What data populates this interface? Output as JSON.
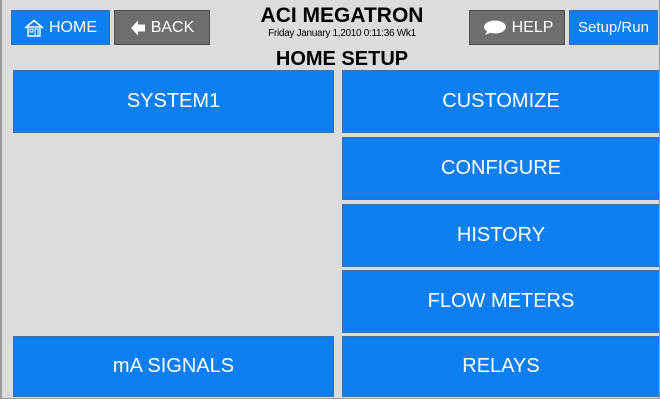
{
  "header": {
    "home_label": "HOME",
    "back_label": "BACK",
    "app_title": "ACI MEGATRON",
    "timestamp": "Friday January 1,2010 0:11:36 Wk1",
    "screen_title": "HOME SETUP",
    "help_label": "HELP",
    "mode_label": "Setup/Run"
  },
  "menu": {
    "system1": "SYSTEM1",
    "ma_signals": "mA SIGNALS",
    "customize": "CUSTOMIZE",
    "configure": "CONFIGURE",
    "history": "HISTORY",
    "flow_meters": "FLOW METERS",
    "relays": "RELAYS"
  },
  "icons": {
    "home": "house-icon",
    "back": "back-arrow-icon",
    "help": "speech-bubble-icon"
  },
  "colors": {
    "button_blue": "#0d7ff2",
    "button_gray": "#6e6e6e",
    "background": "#dcdcdc"
  }
}
